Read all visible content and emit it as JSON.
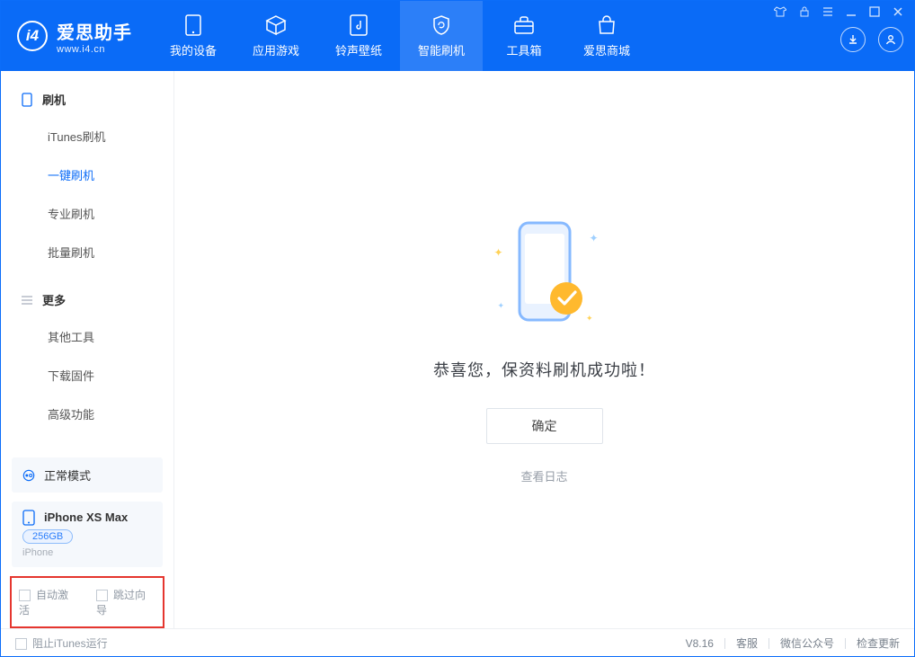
{
  "app": {
    "name": "爱思助手",
    "url": "www.i4.cn"
  },
  "nav": [
    {
      "id": "device",
      "label": "我的设备"
    },
    {
      "id": "apps",
      "label": "应用游戏"
    },
    {
      "id": "ring",
      "label": "铃声壁纸"
    },
    {
      "id": "flash",
      "label": "智能刷机",
      "active": true
    },
    {
      "id": "toolbox",
      "label": "工具箱"
    },
    {
      "id": "store",
      "label": "爱思商城"
    }
  ],
  "sidebar": {
    "section1": {
      "title": "刷机",
      "items": [
        {
          "id": "itunes",
          "label": "iTunes刷机"
        },
        {
          "id": "onekey",
          "label": "一键刷机",
          "active": true
        },
        {
          "id": "pro",
          "label": "专业刷机"
        },
        {
          "id": "batch",
          "label": "批量刷机"
        }
      ]
    },
    "section2": {
      "title": "更多",
      "items": [
        {
          "id": "other",
          "label": "其他工具"
        },
        {
          "id": "firmware",
          "label": "下载固件"
        },
        {
          "id": "advanced",
          "label": "高级功能"
        }
      ]
    },
    "mode": {
      "label": "正常模式"
    },
    "device": {
      "name": "iPhone XS Max",
      "storage": "256GB",
      "type": "iPhone"
    },
    "options": {
      "autoActivate": "自动激活",
      "skipGuide": "跳过向导"
    }
  },
  "main": {
    "message": "恭喜您，保资料刷机成功啦！",
    "okLabel": "确定",
    "logLink": "查看日志"
  },
  "statusbar": {
    "blockItunes": "阻止iTunes运行",
    "version": "V8.16",
    "links": {
      "service": "客服",
      "wechat": "微信公众号",
      "update": "检查更新"
    }
  }
}
